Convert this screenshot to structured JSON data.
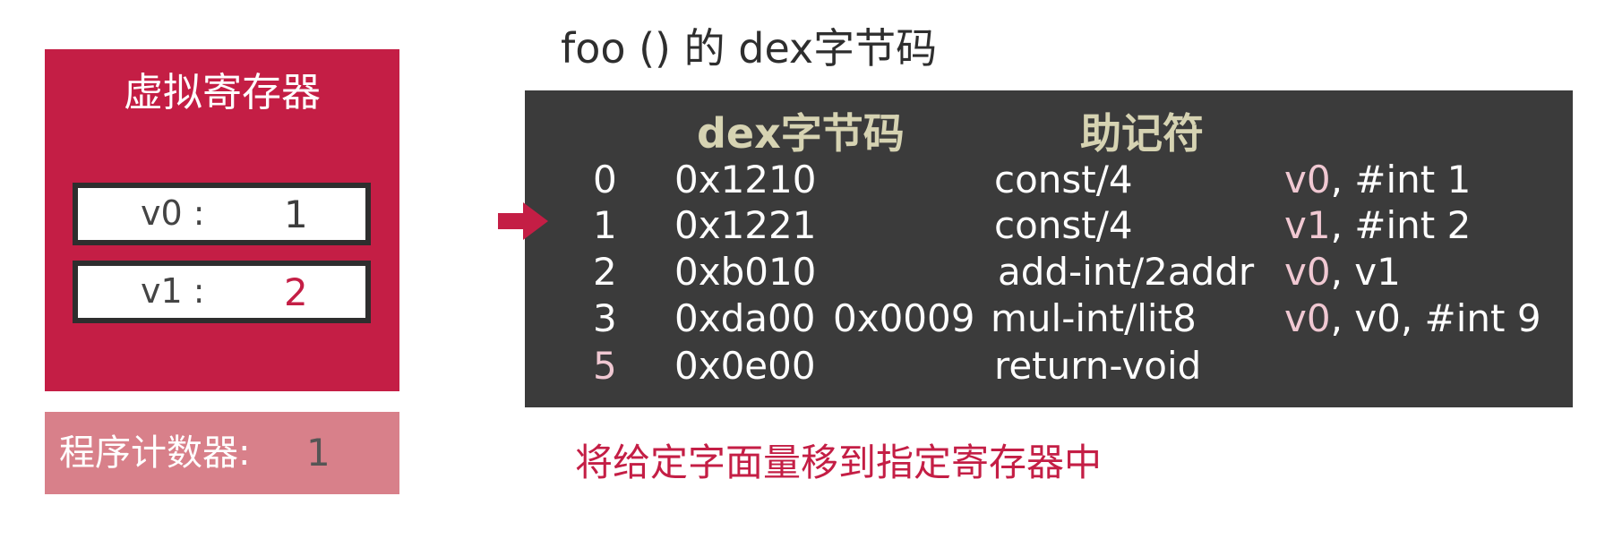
{
  "registers": {
    "title": "虚拟寄存器",
    "items": [
      {
        "name": "v0 :",
        "value": "1"
      },
      {
        "name": "v1 :",
        "value": "2"
      }
    ]
  },
  "program_counter": {
    "label": "程序计数器:",
    "value": "1"
  },
  "code": {
    "title": "foo () 的 dex字节码",
    "headers": {
      "bytecode": "dex字节码",
      "mnemonic": "助记符"
    },
    "rows": [
      {
        "index": "0",
        "hex1": "0x1210",
        "hex2": "",
        "mnemonic": "const/4",
        "op_reg": "v0",
        "op_rest": ", #int 1"
      },
      {
        "index": "1",
        "hex1": "0x1221",
        "hex2": "",
        "mnemonic": "const/4",
        "op_reg": "v1",
        "op_rest": ", #int 2"
      },
      {
        "index": "2",
        "hex1": "0xb010",
        "hex2": "",
        "mnemonic": "add-int/2addr",
        "op_reg": "v0",
        "op_rest": ", v1"
      },
      {
        "index": "3",
        "hex1": "0xda00",
        "hex2": "0x0009",
        "mnemonic": "mul-int/lit8",
        "op_reg": "v0",
        "op_rest": ", v0, #int 9"
      },
      {
        "index": "5",
        "hex1": "0x0e00",
        "hex2": "",
        "mnemonic": "return-void",
        "op_reg": "",
        "op_rest": ""
      }
    ],
    "current_row": 1
  },
  "description": "将给定字面量移到指定寄存器中",
  "colors": {
    "accent": "#c41e45",
    "panel": "#3b3b3b",
    "header_text": "#d6d3b2",
    "operand_highlight": "#f0c8d2",
    "pc_box": "#d8808a"
  },
  "icons": {
    "current_instruction": "right-arrow-icon"
  }
}
